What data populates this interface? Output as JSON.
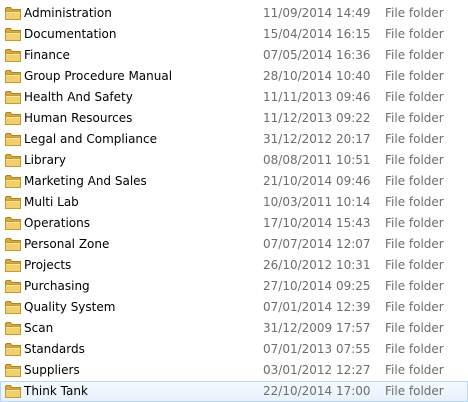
{
  "colors": {
    "folder_front": "#f2cf6b",
    "folder_back": "#d9a838",
    "secondary_text": "#6d6d6d",
    "hover_border": "#b8d6fb"
  },
  "rows": [
    {
      "name": "Administration",
      "date": "11/09/2014 14:49",
      "type": "File folder",
      "icon": "folder-icon"
    },
    {
      "name": "Documentation",
      "date": "15/04/2014 16:15",
      "type": "File folder",
      "icon": "folder-icon"
    },
    {
      "name": "Finance",
      "date": "07/05/2014 16:36",
      "type": "File folder",
      "icon": "folder-icon"
    },
    {
      "name": "Group Procedure Manual",
      "date": "28/10/2014 10:40",
      "type": "File folder",
      "icon": "folder-icon"
    },
    {
      "name": "Health And Safety",
      "date": "11/11/2013 09:46",
      "type": "File folder",
      "icon": "folder-icon"
    },
    {
      "name": "Human Resources",
      "date": "11/12/2013 09:22",
      "type": "File folder",
      "icon": "folder-icon"
    },
    {
      "name": "Legal and Compliance",
      "date": "31/12/2012 20:17",
      "type": "File folder",
      "icon": "folder-icon"
    },
    {
      "name": "Library",
      "date": "08/08/2011 10:51",
      "type": "File folder",
      "icon": "folder-icon"
    },
    {
      "name": "Marketing And Sales",
      "date": "21/10/2014 09:46",
      "type": "File folder",
      "icon": "folder-icon"
    },
    {
      "name": "Multi Lab",
      "date": "10/03/2011 10:14",
      "type": "File folder",
      "icon": "folder-icon"
    },
    {
      "name": "Operations",
      "date": "17/10/2014 15:43",
      "type": "File folder",
      "icon": "folder-icon"
    },
    {
      "name": "Personal Zone",
      "date": "07/07/2014 12:07",
      "type": "File folder",
      "icon": "folder-icon"
    },
    {
      "name": "Projects",
      "date": "26/10/2012 10:31",
      "type": "File folder",
      "icon": "folder-icon"
    },
    {
      "name": "Purchasing",
      "date": "27/10/2014 09:25",
      "type": "File folder",
      "icon": "folder-icon"
    },
    {
      "name": "Quality System",
      "date": "07/01/2014 12:39",
      "type": "File folder",
      "icon": "folder-icon"
    },
    {
      "name": "Scan",
      "date": "31/12/2009 17:57",
      "type": "File folder",
      "icon": "folder-icon"
    },
    {
      "name": "Standards",
      "date": "07/01/2013 07:55",
      "type": "File folder",
      "icon": "folder-icon"
    },
    {
      "name": "Suppliers",
      "date": "03/01/2012 12:27",
      "type": "File folder",
      "icon": "folder-icon"
    },
    {
      "name": "Think Tank",
      "date": "22/10/2014 17:00",
      "type": "File folder",
      "icon": "folder-icon",
      "hovered": true
    }
  ]
}
